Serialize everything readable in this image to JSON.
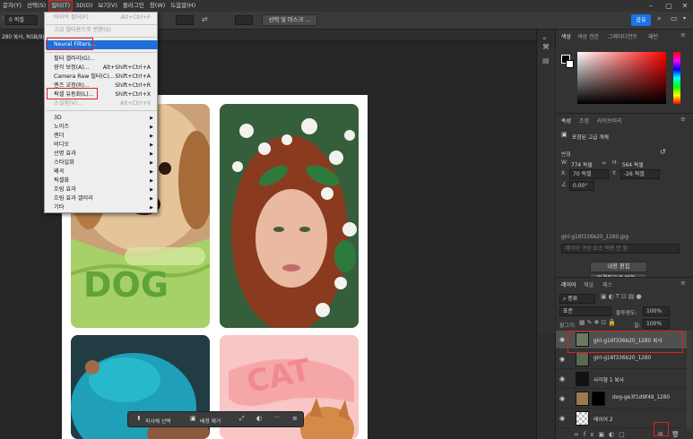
{
  "menubar": {
    "items": [
      "문자(Y)",
      "선택(S)",
      "필터(T)",
      "3D(D)",
      "보기(V)",
      "플러그인",
      "창(W)",
      "도움말(H)"
    ],
    "active_index": 2
  },
  "options_bar": {
    "field1_value": "0 픽셀",
    "mask_button": "선택 및 마스크 ...",
    "share_button": "공유"
  },
  "document_tab": {
    "title": "280 복사, RGB/8)"
  },
  "filter_menu": {
    "items": [
      {
        "label": "마지막 필터(F)",
        "shortcut": "Alt+Ctrl+F",
        "disabled": true
      },
      {
        "label": "고급 필터용으로 변환(S)",
        "disabled": true
      },
      {
        "label": "Neural Filters...",
        "highlight": true
      },
      {
        "label": "필터 갤러리(G)..."
      },
      {
        "label": "광각 보정(A)...",
        "shortcut": "Alt+Shift+Ctrl+A"
      },
      {
        "label": "Camera Raw 필터(C)...",
        "shortcut": "Shift+Ctrl+A"
      },
      {
        "label": "렌즈 교정(R)...",
        "shortcut": "Shift+Ctrl+R"
      },
      {
        "label": "픽셀 유동화(L)...",
        "shortcut": "Shift+Ctrl+X"
      },
      {
        "label": "소실점(V)...",
        "shortcut": "Alt+Ctrl+V",
        "disabled": true
      },
      {
        "label": "3D",
        "submenu": true
      },
      {
        "label": "노이즈",
        "submenu": true
      },
      {
        "label": "렌더",
        "submenu": true
      },
      {
        "label": "비디오",
        "submenu": true
      },
      {
        "label": "선명 효과",
        "submenu": true
      },
      {
        "label": "스타일화",
        "submenu": true
      },
      {
        "label": "왜곡",
        "submenu": true
      },
      {
        "label": "픽셀화",
        "submenu": true
      },
      {
        "label": "흐림 효과",
        "submenu": true
      },
      {
        "label": "흐림 효과 갤러리",
        "submenu": true
      },
      {
        "label": "기타",
        "submenu": true
      }
    ]
  },
  "canvas": {
    "dog_text": "DOG",
    "cat_text": "CAT"
  },
  "context_bar": {
    "select_subject": "피사체 선택",
    "remove_bg": "배경 제거",
    "more": "···"
  },
  "color_panel": {
    "tabs": [
      "색상",
      "색상 견본",
      "그레이디언트",
      "패턴"
    ]
  },
  "properties_panel": {
    "tabs": [
      "속성",
      "조정",
      "라이브러리"
    ],
    "type_label": "포함된 고급 개체",
    "transform_label": "변형",
    "w_label": "W:",
    "w_value": "774 픽셀",
    "h_label": "H:",
    "h_value": "564 픽셀",
    "x_label": "X:",
    "x_value": "70 픽셀",
    "y_label": "Y:",
    "y_value": "-26 픽셀",
    "angle_value": "0.00°",
    "filename": "girl-g16f336b20_1280.jpg",
    "comp_placeholder": "레이어 구성 요소 적용 안 함",
    "edit_button": "내용 편집",
    "convert_button": "연결됨으로 변환..."
  },
  "layers_panel": {
    "tabs": [
      "레이어",
      "채널",
      "패스"
    ],
    "kind_label": "종류",
    "blend_mode": "표준",
    "opacity_label": "불투명도:",
    "opacity_value": "100%",
    "lock_label": "잠그기:",
    "fill_label": "칠:",
    "fill_value": "100%",
    "layers": [
      {
        "name": "girl-g16f336b20_1280 복사",
        "selected": true
      },
      {
        "name": "girl-g16f336b20_1280"
      },
      {
        "name": "사각형 1 복사"
      },
      {
        "name": "dog-ge3f1d9f49_1280"
      },
      {
        "name": "레이어 2"
      }
    ]
  },
  "colors": {
    "highlight_red": "#e02020",
    "menu_blue": "#1e6fd9",
    "share_blue": "#1a73e8",
    "dog_green": "#9ccf5a",
    "cat_pink": "#f6b8b8"
  }
}
